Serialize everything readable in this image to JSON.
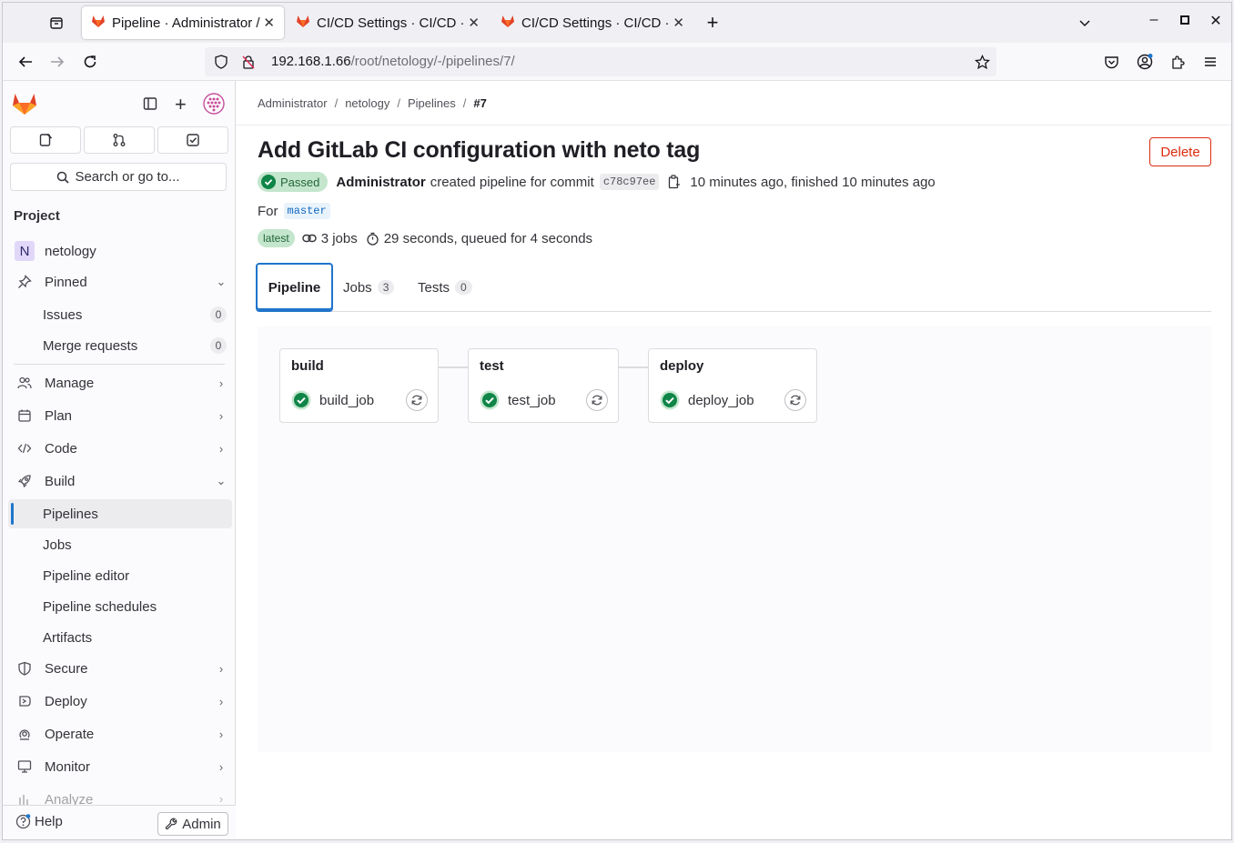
{
  "browser": {
    "tabs": [
      {
        "label": "Pipeline · Administrator / ",
        "active": true
      },
      {
        "label": "CI/CD Settings · CI/CD · S",
        "active": false
      },
      {
        "label": "CI/CD Settings · CI/CD · S",
        "active": false
      }
    ],
    "url_host": "192.168.1.66",
    "url_path": "/root/netology/-/pipelines/7/"
  },
  "sidebar": {
    "search_label": "Search or go to...",
    "section_heading": "Project",
    "project_initial": "N",
    "project_name": "netology",
    "pinned_label": "Pinned",
    "pinned_items": [
      {
        "label": "Issues",
        "count": "0"
      },
      {
        "label": "Merge requests",
        "count": "0"
      }
    ],
    "groups": [
      {
        "label": "Manage",
        "icon": "users-icon"
      },
      {
        "label": "Plan",
        "icon": "calendar-icon"
      },
      {
        "label": "Code",
        "icon": "code-icon"
      },
      {
        "label": "Build",
        "icon": "rocket-icon"
      }
    ],
    "build_items": [
      "Pipelines",
      "Jobs",
      "Pipeline editor",
      "Pipeline schedules",
      "Artifacts"
    ],
    "lower_groups": [
      {
        "label": "Secure",
        "icon": "shield-icon"
      },
      {
        "label": "Deploy",
        "icon": "deploy-icon"
      },
      {
        "label": "Operate",
        "icon": "cloud-icon"
      },
      {
        "label": "Monitor",
        "icon": "monitor-icon"
      },
      {
        "label": "Analyze",
        "icon": "chart-icon"
      }
    ],
    "help_label": "Help",
    "admin_label": "Admin"
  },
  "breadcrumb": [
    "Administrator",
    "netology",
    "Pipelines",
    "#7"
  ],
  "pipeline": {
    "title": "Add GitLab CI configuration with neto tag",
    "delete_label": "Delete",
    "status": "Passed",
    "author": "Administrator",
    "created_text": "created pipeline for commit",
    "sha": "c78c97ee",
    "timing_text": "10 minutes ago, finished 10 minutes ago",
    "for_label": "For",
    "branch": "master",
    "latest_label": "latest",
    "jobs_text": "3 jobs",
    "duration_text": "29 seconds, queued for 4 seconds"
  },
  "tabs": [
    {
      "label": "Pipeline",
      "count": null
    },
    {
      "label": "Jobs",
      "count": "3"
    },
    {
      "label": "Tests",
      "count": "0"
    }
  ],
  "stages": [
    {
      "name": "build",
      "job": "build_job",
      "status": "success"
    },
    {
      "name": "test",
      "job": "test_job",
      "status": "success"
    },
    {
      "name": "deploy",
      "job": "deploy_job",
      "status": "success"
    }
  ],
  "colors": {
    "success": "#108548",
    "danger": "#dd2b0e",
    "link": "#1f75cb",
    "brand": "#fc6d26"
  }
}
